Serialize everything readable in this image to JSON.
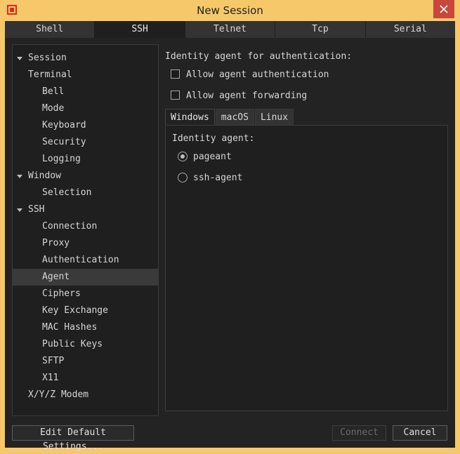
{
  "window": {
    "title": "New Session",
    "brand_color": "#e0281f",
    "titlebar_color": "#f6c86a",
    "close_icon": "close-icon"
  },
  "tabs": [
    {
      "label": "Shell",
      "active": false
    },
    {
      "label": "SSH",
      "active": true
    },
    {
      "label": "Telnet",
      "active": false
    },
    {
      "label": "Tcp",
      "active": false
    },
    {
      "label": "Serial",
      "active": false
    }
  ],
  "tree": {
    "items": [
      {
        "label": "Session",
        "level": 0,
        "expandable": false
      },
      {
        "label": "Terminal",
        "level": 0,
        "expandable": true
      },
      {
        "label": "Bell",
        "level": 1
      },
      {
        "label": "Mode",
        "level": 1
      },
      {
        "label": "Keyboard",
        "level": 1
      },
      {
        "label": "Security",
        "level": 1
      },
      {
        "label": "Logging",
        "level": 1
      },
      {
        "label": "Window",
        "level": 0,
        "expandable": true
      },
      {
        "label": "Selection",
        "level": 1
      },
      {
        "label": "SSH",
        "level": 0,
        "expandable": true
      },
      {
        "label": "Connection",
        "level": 1
      },
      {
        "label": "Proxy",
        "level": 1
      },
      {
        "label": "Authentication",
        "level": 1
      },
      {
        "label": "Agent",
        "level": 1,
        "selected": true
      },
      {
        "label": "Ciphers",
        "level": 1
      },
      {
        "label": "Key Exchange",
        "level": 1
      },
      {
        "label": "MAC Hashes",
        "level": 1
      },
      {
        "label": "Public Keys",
        "level": 1
      },
      {
        "label": "SFTP",
        "level": 1
      },
      {
        "label": "X11",
        "level": 1
      },
      {
        "label": "X/Y/Z Modem",
        "level": 0,
        "expandable": false
      }
    ]
  },
  "agent": {
    "heading": "Identity agent for authentication:",
    "allow_auth_label": "Allow agent authentication",
    "allow_auth_checked": false,
    "allow_forward_label": "Allow agent forwarding",
    "allow_forward_checked": false,
    "subtabs": [
      "Windows",
      "macOS",
      "Linux"
    ],
    "active_subtab": "Windows",
    "identity_label": "Identity agent:",
    "options": [
      {
        "label": "pageant",
        "checked": true
      },
      {
        "label": "ssh-agent",
        "checked": false
      }
    ]
  },
  "footer": {
    "edit_defaults_label": "Edit Default Settings...",
    "connect_label": "Connect",
    "connect_disabled": true,
    "cancel_label": "Cancel"
  }
}
